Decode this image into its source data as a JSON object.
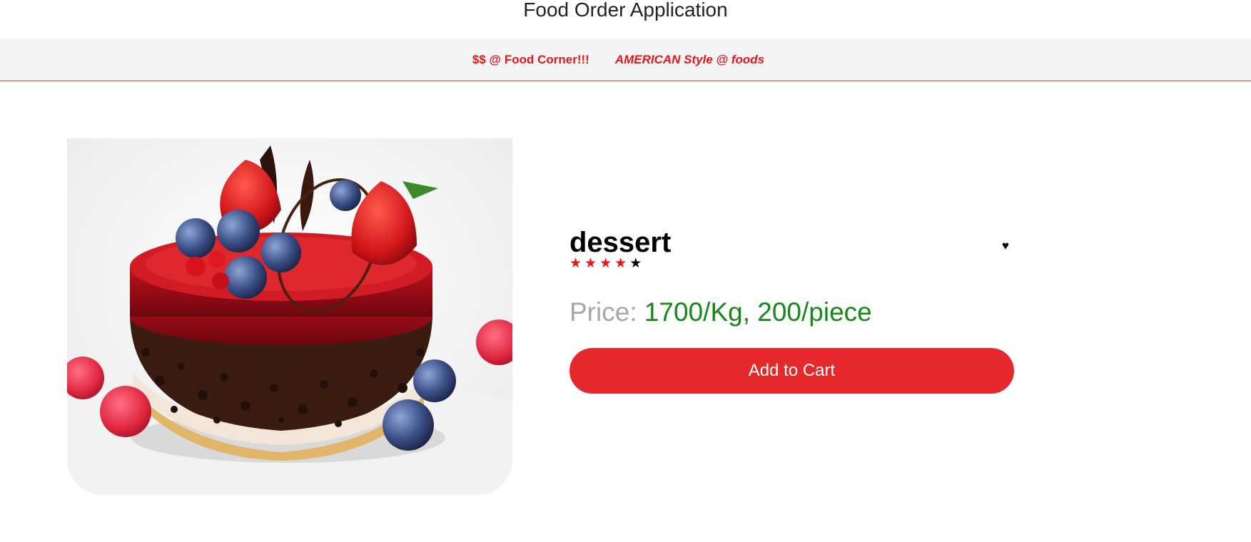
{
  "app": {
    "title": "Food Order Application"
  },
  "nav": {
    "items": [
      {
        "label": "$$ @ Food Corner!!!"
      },
      {
        "label": "AMERICAN Style @ foods"
      }
    ]
  },
  "product": {
    "name": "dessert",
    "favorite_icon": "heart-icon",
    "favorite_glyph": "♥",
    "rating": 4,
    "rating_max": 5,
    "stars": [
      "★",
      "★",
      "★",
      "★",
      "★"
    ],
    "price_label": "Price:",
    "price_value": "1700/Kg, 200/piece",
    "image_alt": "dessert"
  },
  "actions": {
    "add_to_cart": "Add to Cart"
  },
  "colors": {
    "accent": "#e8151b",
    "button": "#e5282c",
    "price": "#16891a",
    "price_label": "#a7a7a7",
    "nav_bg": "#f4f4f5"
  }
}
